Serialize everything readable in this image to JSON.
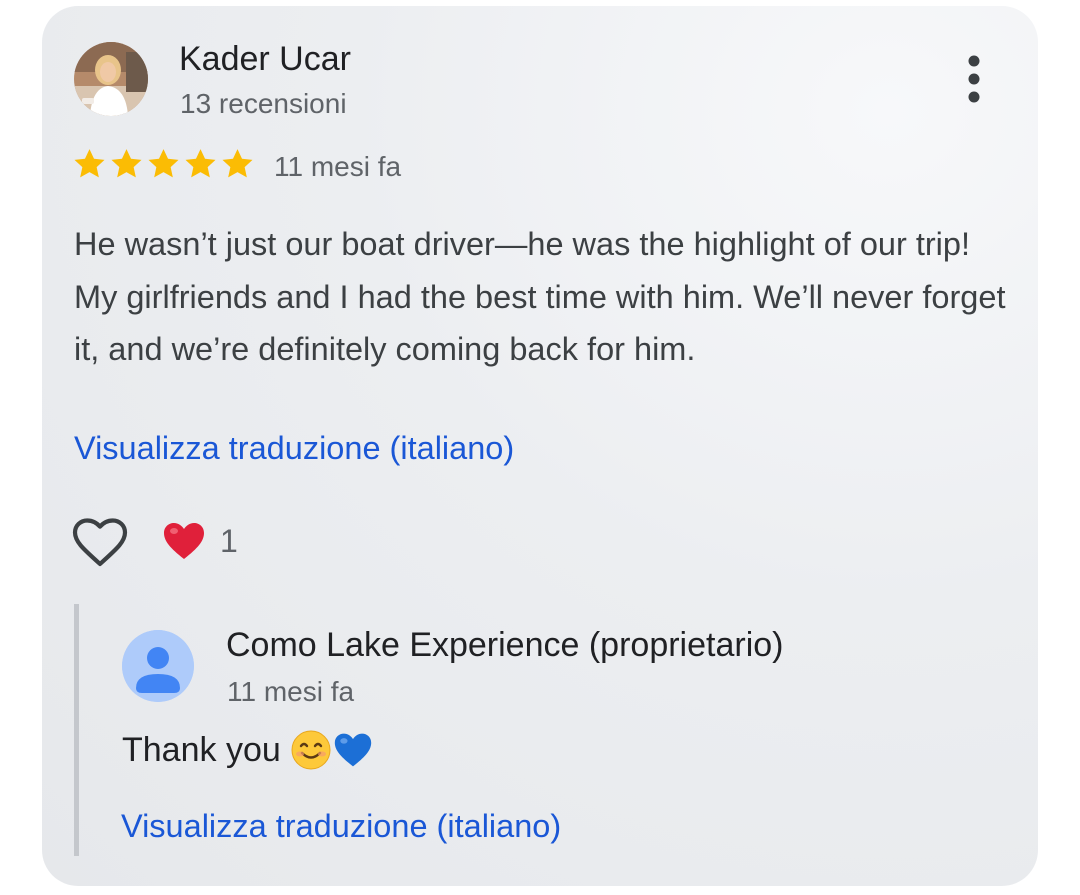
{
  "review": {
    "reviewer_name": "Kader Ucar",
    "reviewer_meta": "13 recensioni",
    "rating": 5,
    "max_rating": 5,
    "time": "11 mesi fa",
    "text": "He wasn’t just our boat driver—he was the highlight of our trip! My girlfriends and I had the best time with him. We’ll never forget it, and we’re definitely coming back for him.",
    "translate_label": "Visualizza traduzione (italiano)",
    "reaction_count": "1"
  },
  "owner_reply": {
    "name": "Como Lake Experience (proprietario)",
    "time": "11 mesi fa",
    "text": "Thank you",
    "translate_label": "Visualizza traduzione (italiano)"
  },
  "colors": {
    "star": "#fbbc04",
    "link": "#1a57d6",
    "heart_reaction": "#e0203a",
    "blue_heart": "#1c6fd6"
  },
  "icons": {
    "more": "more-vert-icon",
    "like": "heart-outline-icon",
    "reaction": "red-heart-emoji-icon",
    "reply_emojis": [
      "smiling-face-icon",
      "blue-heart-icon"
    ]
  }
}
